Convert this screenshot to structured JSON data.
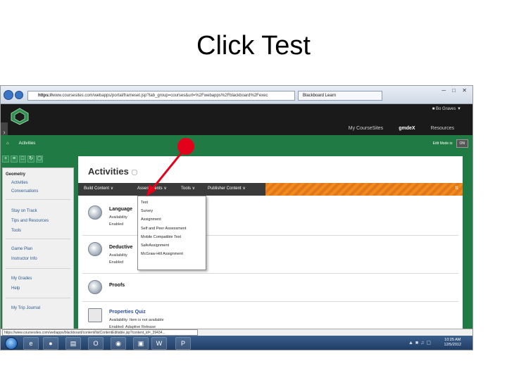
{
  "slide": {
    "title": "Click Test"
  },
  "browser": {
    "url_scheme": "https://",
    "url_rest": "www.coursesites.com/webapps/portal/frameset.jsp?tab_group=courses&url=%2Fwebapps%2Fblackboard%2Fexec",
    "tab_label": "Blackboard Learn",
    "status_url": "https://www.coursesites.com/webapps/blackboard/content/listContentEditable.jsp?content_id=_39434..."
  },
  "bb_header": {
    "user_name": "Bo Graves",
    "tabs": [
      "My CourseSites",
      "gmdeX",
      "Resources"
    ]
  },
  "breadcrumb": "Activities",
  "edit_mode": {
    "label": "Edit Mode is:",
    "state": "ON"
  },
  "sidebar": {
    "course": "Geometry",
    "items": [
      "Activities",
      "Conversations",
      "Stay on Track",
      "Tips and Resources",
      "Tools",
      "Game Plan",
      "Instructor Info",
      "My Grades",
      "Help",
      "My Trip Journal"
    ]
  },
  "content": {
    "title": "Activities",
    "action_bar": [
      "Build Content",
      "Assessments",
      "Tools",
      "Publisher Content"
    ],
    "items": [
      {
        "title": "Language",
        "meta1": "Availability",
        "meta2": "Enabled"
      },
      {
        "title": "Deductive",
        "meta1": "Availability",
        "meta2": "Enabled"
      },
      {
        "title": "Proofs"
      },
      {
        "title": "Properties Quiz",
        "meta1": "Availability:  Item is not available",
        "meta2": "Enabled:  Adaptive Release"
      }
    ]
  },
  "dropdown": {
    "items": [
      "Test",
      "Survey",
      "Assignment",
      "Self and Peer Assessment",
      "Mobile Compatible Test",
      "SafeAssignment",
      "McGraw-Hill Assignment"
    ]
  },
  "taskbar": {
    "time": "10:25 AM",
    "date": "12/5/2012"
  },
  "colors": {
    "bb_green": "#1f7a43",
    "action_orange": "#f28a1d",
    "annotation_red": "#e3001b"
  }
}
